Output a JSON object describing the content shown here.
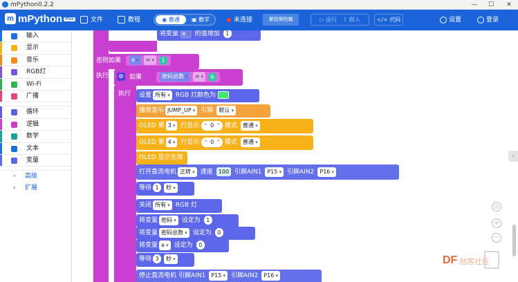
{
  "window": {
    "title": "mPython0.2.2"
  },
  "toolbar": {
    "logo": "mPython",
    "logo_badge": "Plus",
    "file": "文件",
    "tutorial": "教程",
    "mode_normal": "普通",
    "mode_teach": "教学",
    "connection": "未连接",
    "selected_file": "掌控保险箱",
    "run": "运行",
    "flash": "刷入",
    "code": "代码",
    "settings": "设置",
    "login": "登录"
  },
  "sidebar": {
    "items": [
      {
        "label": "输入",
        "color": "#1e6fd9"
      },
      {
        "label": "显示",
        "color": "#f5b316"
      },
      {
        "label": "音乐",
        "color": "#f28c1e"
      },
      {
        "label": "RGB灯",
        "color": "#7a55d8"
      },
      {
        "label": "Wi-Fi",
        "color": "#2db34a"
      },
      {
        "label": "广播",
        "color": "#e0467a"
      },
      {
        "label": "循环",
        "color": "#5b5fe0"
      },
      {
        "label": "逻辑",
        "color": "#c93fcf"
      },
      {
        "label": "数学",
        "color": "#1aa39d"
      },
      {
        "label": "文本",
        "color": "#1e6fd9"
      },
      {
        "label": "变量",
        "color": "#5b66e8"
      }
    ],
    "advanced": "高级",
    "extensions": "扩展"
  },
  "blocks": {
    "top_set": "将变量",
    "top_var": "a",
    "top_increase": "的值增加",
    "top_value": "1",
    "else_if": "否则如果",
    "exec1": "执行",
    "cond1_var": "a",
    "cond1_op": "=",
    "cond1_val": "1",
    "if_label": "如果",
    "cond2_var": "密码总数",
    "cond2_op": "=",
    "cond2_val": "6",
    "exec2": "执行",
    "rgb_set": "设置",
    "rgb_which": "所有",
    "rgb_color_label": "RGB 灯颜色为",
    "music_play": "播放音乐",
    "music_name": "JUMP_UP",
    "music_pin_label": "引脚",
    "music_pin": "默认",
    "oled1_prefix": "OLED 第",
    "oled1_line": "3",
    "oled1_mid": "行显示",
    "oled1_text": "0",
    "oled1_mode_label": "模式",
    "oled1_mode": "普通",
    "oled2_prefix": "OLED 第",
    "oled2_line": "4",
    "oled2_mid": "行显示",
    "oled2_text": "0",
    "oled2_mode_label": "模式",
    "oled2_mode": "普通",
    "oled_show": "OLED 显示生效",
    "motor_open": "打开直流电机",
    "motor_dir": "正转",
    "motor_speed_label": "速度",
    "motor_speed": "100",
    "motor_pin1_label": "引脚AIN1",
    "motor_pin1": "P15",
    "motor_pin2_label": "引脚AIN2",
    "motor_pin2": "P16",
    "wait1_label": "等待",
    "wait1_val": "1",
    "wait1_unit": "秒",
    "rgb_off": "关闭",
    "rgb_off_which": "所有",
    "rgb_off_label": "RGB 灯",
    "set1_label": "将变量",
    "set1_var": "密码",
    "set1_to": "设定为",
    "set1_val": "1",
    "set2_label": "将变量",
    "set2_var": "密码总数",
    "set2_to": "设定为",
    "set2_val": "0",
    "set3_label": "将变量",
    "set3_var": "a",
    "set3_to": "设定为",
    "set3_val": "0",
    "wait2_label": "等待",
    "wait2_val": "3",
    "wait2_unit": "秒",
    "motor_stop": "停止直流电机",
    "stop_pin1_label": "引脚AIN1",
    "stop_pin1": "P15",
    "stop_pin2_label": "引脚AIN2",
    "stop_pin2": "P16"
  },
  "watermark": {
    "brand": "DF",
    "text": "创客社区"
  }
}
